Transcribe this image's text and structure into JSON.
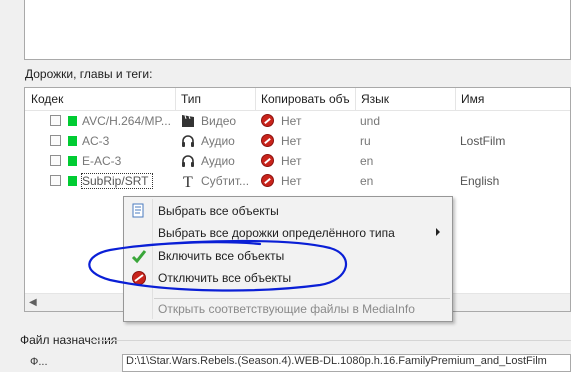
{
  "section": {
    "tracks_label": "Дорожки, главы и теги:",
    "dest_label": "Файл назначения",
    "dest_side_label": "Ф...",
    "dest_path": "D:\\1\\Star.Wars.Rebels.(Season.4).WEB-DL.1080p.h.16.FamilyPremium_and_LostFilm"
  },
  "table": {
    "columns": [
      "Кодек",
      "Тип",
      "Копировать объ",
      "Язык",
      "Имя"
    ],
    "rows": [
      {
        "codec": "AVC/H.264/MP...",
        "type": "Видео",
        "type_icon": "film-clapper-icon",
        "copy": "Нет",
        "lang": "und",
        "name": "",
        "color": "#00cc33"
      },
      {
        "codec": "AC-3",
        "type": "Аудио",
        "type_icon": "headphones-icon",
        "copy": "Нет",
        "lang": "ru",
        "name": "LostFilm",
        "color": "#00cc33"
      },
      {
        "codec": "E-AC-3",
        "type": "Аудио",
        "type_icon": "headphones-icon",
        "copy": "Нет",
        "lang": "en",
        "name": "",
        "color": "#00cc33"
      },
      {
        "codec": "SubRip/SRT",
        "type": "Субтит...",
        "type_icon": "text-t-icon",
        "copy": "Нет",
        "lang": "en",
        "name": "English",
        "color": "#00cc33"
      }
    ]
  },
  "context_menu": {
    "items": [
      {
        "label": "Выбрать все объекты",
        "icon": "select-all-icon"
      },
      {
        "label": "Выбрать все дорожки определённого типа",
        "has_submenu": true
      },
      {
        "label": "Включить все объекты",
        "icon": "green-check-icon"
      },
      {
        "label": "Отключить все объекты",
        "icon": "red-no-icon"
      },
      {
        "label": "Открыть соответствующие файлы в MediaInfo",
        "disabled": true
      }
    ]
  },
  "colors": {
    "annotation_stroke": "#0a1fd6",
    "no_icon": "#c9241c",
    "check_green": "#3aa63a"
  }
}
